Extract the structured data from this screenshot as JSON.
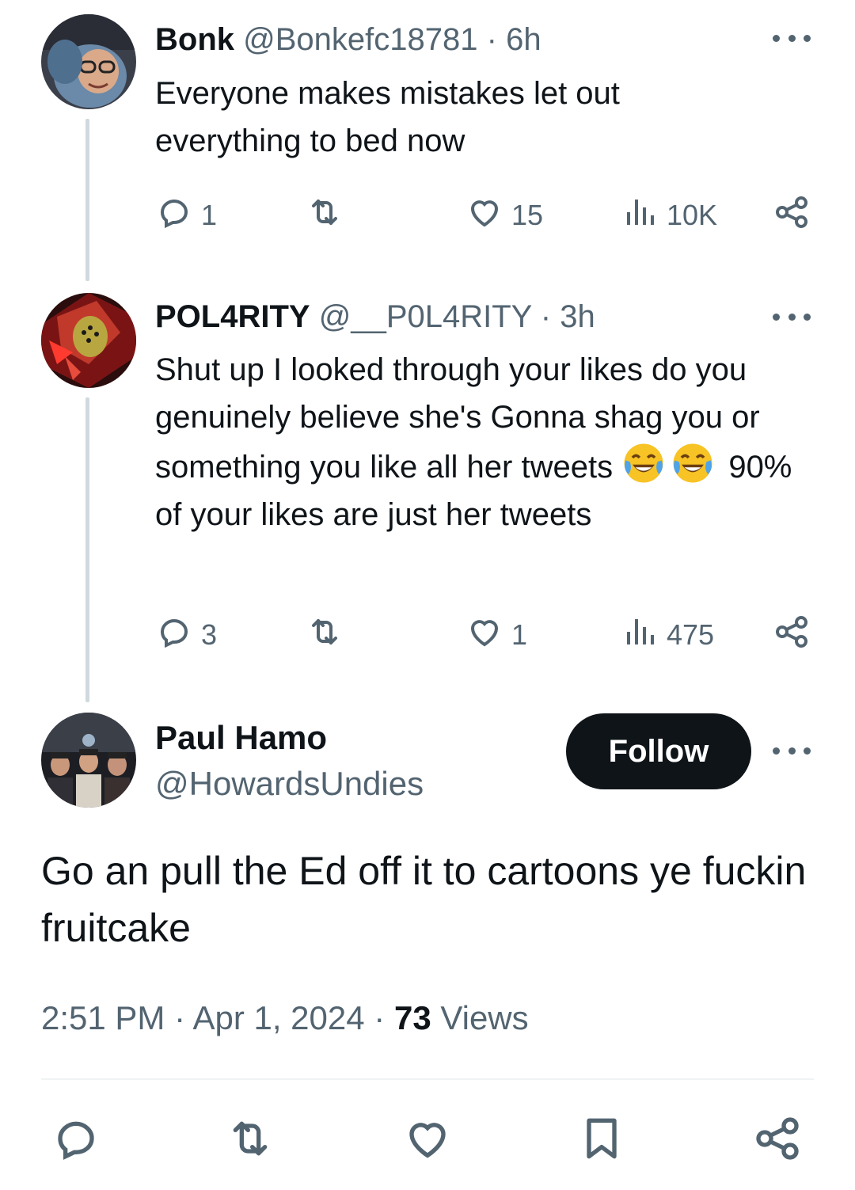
{
  "tweets": [
    {
      "name": "Bonk",
      "handle": "@Bonkefc18781",
      "time": "6h",
      "text": "Everyone makes mistakes let out everything to bed now",
      "replies": "1",
      "retweets": "",
      "likes": "15",
      "views": "10K"
    },
    {
      "name": "POL4RITY",
      "handle": "@__P0L4RITY",
      "time": "3h",
      "text_line1": "Shut up I looked through your likes do you genuinely believe she's Gonna shag you or something you like all her tweets",
      "text_emoji": "😂😂",
      "text_line2": " 90% of your likes are just her tweets",
      "replies": "3",
      "retweets": "",
      "likes": "1",
      "views": "475"
    }
  ],
  "main": {
    "name": "Paul Hamo",
    "handle": "@HowardsUndies",
    "follow_label": "Follow",
    "text": "Go an pull the Ed off it to cartoons ye fuckin fruitcake",
    "time": "2:51 PM",
    "date": "Apr 1, 2024",
    "views_count": "73",
    "views_label": "Views"
  },
  "separator": "·",
  "icons": {
    "reply": "reply-icon",
    "retweet": "retweet-icon",
    "like": "heart-icon",
    "views": "views-icon",
    "share": "share-icon",
    "bookmark": "bookmark-icon",
    "more": "more-icon"
  },
  "colors": {
    "text": "#0f1419",
    "secondary": "#536471",
    "thread_line": "#cfd9de",
    "follow_bg": "#0f1419"
  }
}
